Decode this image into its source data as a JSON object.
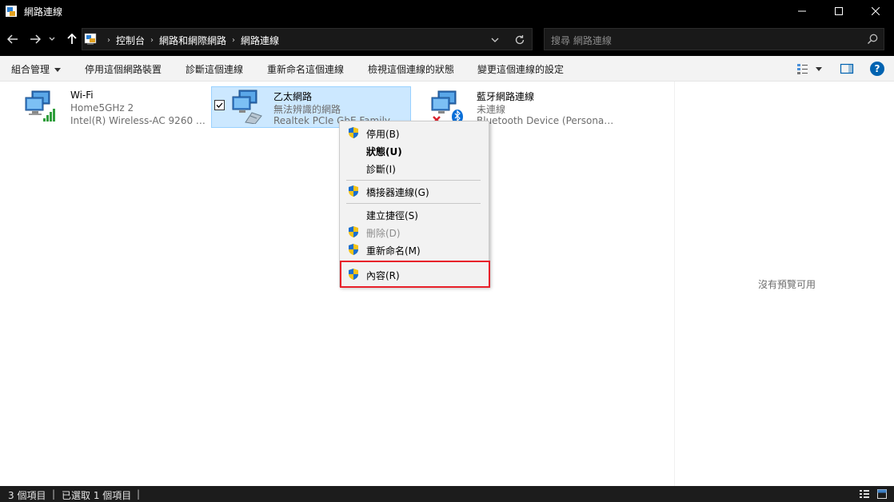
{
  "window": {
    "title": "網路連線",
    "icon": "network-connections-icon"
  },
  "navigation": {
    "breadcrumbs": [
      "控制台",
      "網路和網際網路",
      "網路連線"
    ],
    "search_placeholder": "搜尋 網路連線"
  },
  "commands": {
    "organize": "組合管理",
    "disable_device": "停用這個網路裝置",
    "diagnose": "診斷這個連線",
    "rename": "重新命名這個連線",
    "view_status": "檢視這個連線的狀態",
    "change_settings": "變更這個連線的設定"
  },
  "connections": [
    {
      "name": "Wi-Fi",
      "status": "Home5GHz 2",
      "device": "Intel(R) Wireless-AC 9260 1...",
      "icon": "wifi-adapter-icon",
      "selected": false
    },
    {
      "name": "乙太網路",
      "status": "無法辨識的網路",
      "device": "Realtek PCIe GbE Family Co...",
      "icon": "ethernet-adapter-icon",
      "selected": true
    },
    {
      "name": "藍牙網路連線",
      "status": "未連線",
      "device": "Bluetooth Device (Personal ...",
      "icon": "bluetooth-adapter-icon",
      "selected": false
    }
  ],
  "context_menu": {
    "items": [
      {
        "label": "停用(B)",
        "shield": true,
        "bold": false,
        "disabled": false
      },
      {
        "label": "狀態(U)",
        "shield": false,
        "bold": true,
        "disabled": false
      },
      {
        "label": "診斷(I)",
        "shield": false,
        "bold": false,
        "disabled": false
      },
      {
        "label": "橋接器連線(G)",
        "shield": true,
        "bold": false,
        "disabled": false
      },
      {
        "label": "建立捷徑(S)",
        "shield": false,
        "bold": false,
        "disabled": false
      },
      {
        "label": "刪除(D)",
        "shield": true,
        "bold": false,
        "disabled": true
      },
      {
        "label": "重新命名(M)",
        "shield": true,
        "bold": false,
        "disabled": false
      },
      {
        "label": "內容(R)",
        "shield": true,
        "bold": false,
        "disabled": false,
        "highlighted": true
      }
    ],
    "highlight_color": "#e8202a"
  },
  "preview": {
    "message": "沒有預覽可用"
  },
  "status_bar": {
    "item_count": "3 個項目",
    "selected_count": "已選取 1 個項目"
  },
  "colors": {
    "selection": "#cce8ff",
    "help_blue": "#0063b1"
  }
}
